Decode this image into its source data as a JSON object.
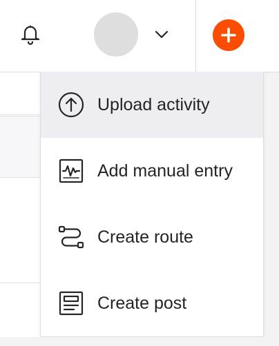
{
  "header": {
    "bell_icon": "bell-icon",
    "avatar_icon": "avatar",
    "chevron_icon": "chevron-down-icon",
    "add_icon": "plus-icon",
    "accent_color": "#fc4c02"
  },
  "menu": {
    "items": [
      {
        "label": "Upload activity",
        "icon": "upload-icon",
        "active": true
      },
      {
        "label": "Add manual entry",
        "icon": "manual-entry-icon",
        "active": false
      },
      {
        "label": "Create route",
        "icon": "route-icon",
        "active": false
      },
      {
        "label": "Create post",
        "icon": "post-icon",
        "active": false
      }
    ]
  }
}
